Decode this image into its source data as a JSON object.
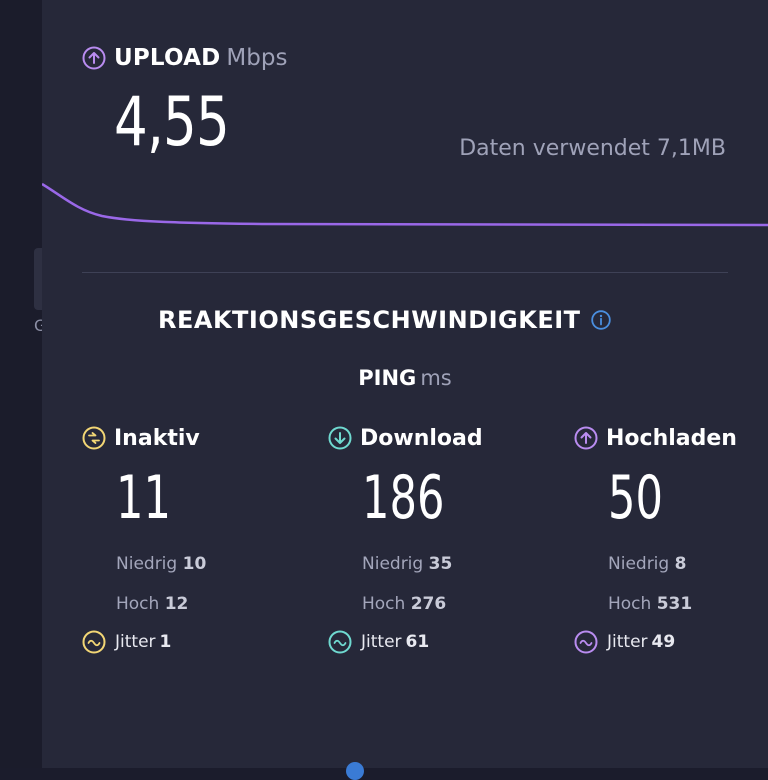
{
  "upload": {
    "title": "UPLOAD",
    "unit": "Mbps",
    "value": "4,55",
    "data_used": "Daten verwendet 7,1MB"
  },
  "latency": {
    "section_title": "REAKTIONSGESCHWINDIGKEIT",
    "ping_label": "PING",
    "ping_unit": "ms",
    "columns": [
      {
        "name": "Inaktiv",
        "value": "11",
        "low_label": "Niedrig",
        "low": "10",
        "high_label": "Hoch",
        "high": "12",
        "jitter_label": "Jitter",
        "jitter": "1",
        "color": "#f2d675",
        "icon": "idle-icon"
      },
      {
        "name": "Download",
        "value": "186",
        "low_label": "Niedrig",
        "low": "35",
        "high_label": "Hoch",
        "high": "276",
        "jitter_label": "Jitter",
        "jitter": "61",
        "color": "#6fd9d0",
        "icon": "download-arrow-icon"
      },
      {
        "name": "Hochladen",
        "value": "50",
        "low_label": "Niedrig",
        "low": "8",
        "high_label": "Hoch",
        "high": "531",
        "jitter_label": "Jitter",
        "jitter": "49",
        "color": "#b98cf0",
        "icon": "upload-arrow-icon"
      }
    ]
  },
  "colors": {
    "upload_accent": "#b98cf0",
    "info": "#4a8fe0",
    "background": "#262839"
  }
}
